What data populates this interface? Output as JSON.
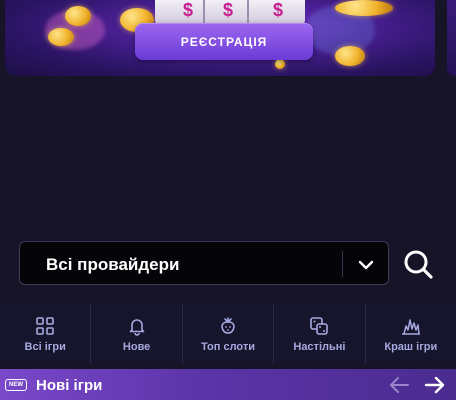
{
  "banner": {
    "register_label": "РЕЄСТРАЦІЯ",
    "slot_symbols": [
      "$",
      "$",
      "$"
    ]
  },
  "providers": {
    "selected": "Всі провайдери"
  },
  "tabs": [
    {
      "label": "Всі ігри",
      "icon": "grid-icon"
    },
    {
      "label": "Нове",
      "icon": "bell-icon"
    },
    {
      "label": "Топ слоти",
      "icon": "strawberry-icon"
    },
    {
      "label": "Настільні",
      "icon": "dice-icon"
    },
    {
      "label": "Краш ігри",
      "icon": "explosion-icon"
    }
  ],
  "new_games": {
    "badge": "NEW",
    "title": "Нові ігри"
  },
  "colors": {
    "background": "#161426",
    "tab_label": "#a6a9e0",
    "accent_purple": "#7a48c9"
  }
}
